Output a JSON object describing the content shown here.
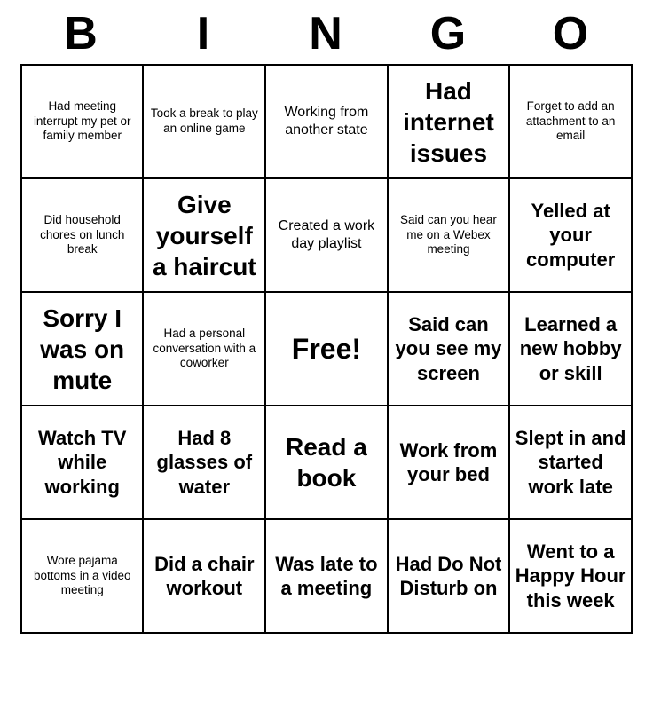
{
  "header": {
    "letters": [
      "B",
      "I",
      "N",
      "G",
      "O"
    ]
  },
  "grid": [
    [
      {
        "text": "Had meeting interrupt my pet or family member",
        "size": "small"
      },
      {
        "text": "Took a break to play an online game",
        "size": "small"
      },
      {
        "text": "Working from another state",
        "size": "medium"
      },
      {
        "text": "Had internet issues",
        "size": "xlarge"
      },
      {
        "text": "Forget to add an attachment to an email",
        "size": "small"
      }
    ],
    [
      {
        "text": "Did household chores on lunch break",
        "size": "small"
      },
      {
        "text": "Give yourself a haircut",
        "size": "xlarge"
      },
      {
        "text": "Created a work day playlist",
        "size": "medium"
      },
      {
        "text": "Said can you hear me on a Webex meeting",
        "size": "small"
      },
      {
        "text": "Yelled at your computer",
        "size": "large"
      }
    ],
    [
      {
        "text": "Sorry I was on mute",
        "size": "xlarge"
      },
      {
        "text": "Had a personal conversation with a coworker",
        "size": "small"
      },
      {
        "text": "Free!",
        "size": "free"
      },
      {
        "text": "Said can you see my screen",
        "size": "large"
      },
      {
        "text": "Learned a new hobby or skill",
        "size": "large"
      }
    ],
    [
      {
        "text": "Watch TV while working",
        "size": "large"
      },
      {
        "text": "Had 8 glasses of water",
        "size": "large"
      },
      {
        "text": "Read a book",
        "size": "xlarge"
      },
      {
        "text": "Work from your bed",
        "size": "large"
      },
      {
        "text": "Slept in and started work late",
        "size": "large"
      }
    ],
    [
      {
        "text": "Wore pajama bottoms in a video meeting",
        "size": "small"
      },
      {
        "text": "Did a chair workout",
        "size": "large"
      },
      {
        "text": "Was late to a meeting",
        "size": "large"
      },
      {
        "text": "Had Do Not Disturb on",
        "size": "large"
      },
      {
        "text": "Went to a Happy Hour this week",
        "size": "large"
      }
    ]
  ]
}
